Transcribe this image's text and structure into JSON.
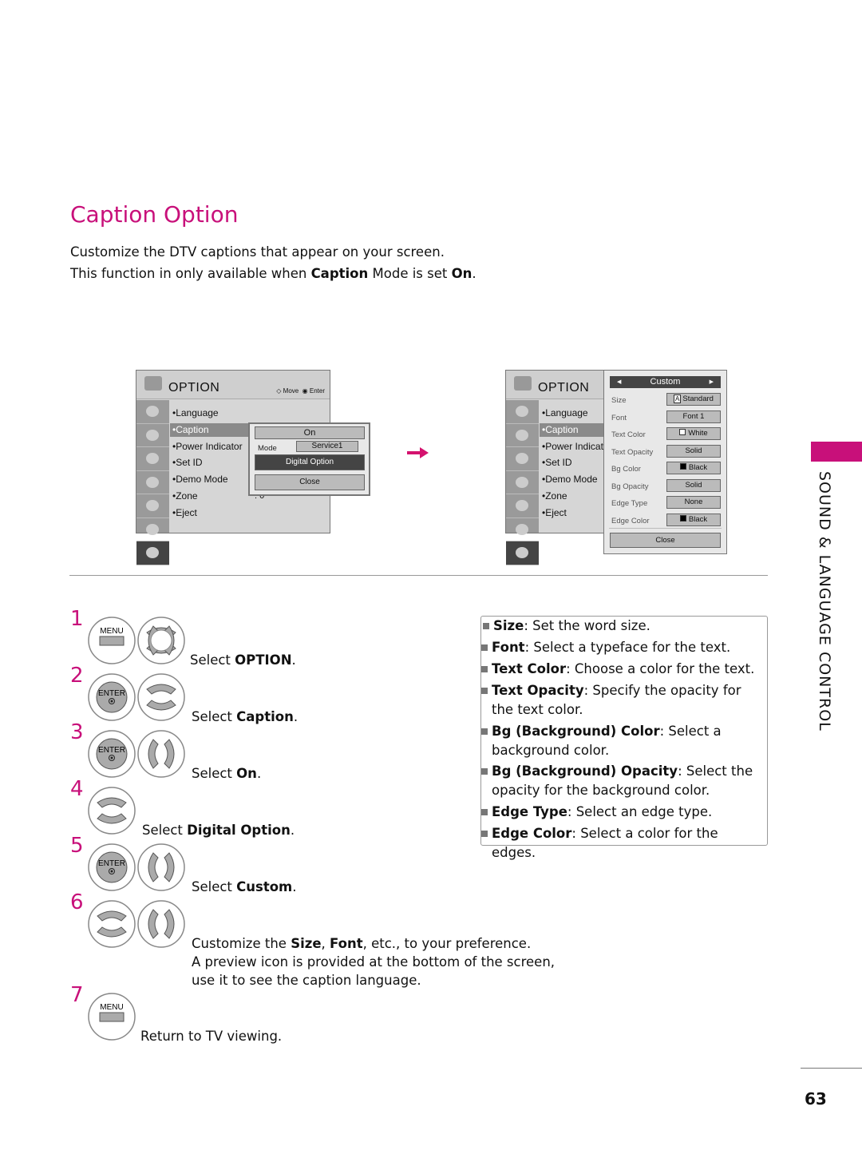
{
  "title": "Caption Option",
  "intro": {
    "line1": "Customize the DTV captions that appear on your screen.",
    "line2_pre": "This function in only available when ",
    "line2_b": "Caption",
    "line2_mid": " Mode is set ",
    "line2_b2": "On",
    "line2_end": "."
  },
  "menu_left": {
    "title": "OPTION",
    "hint_move": "Move",
    "hint_enter": "Enter",
    "items": [
      "Language",
      "Caption",
      "Power Indicator",
      "Set ID",
      "Demo Mode",
      "Zone",
      "Eject"
    ],
    "zone_value": ": 0",
    "popup": {
      "on": "On",
      "mode_label": "Mode",
      "mode_value": "Service1",
      "digital": "Digital Option",
      "close": "Close"
    }
  },
  "menu_right": {
    "title": "OPTION",
    "items": [
      "Language",
      "Caption",
      "Power Indicate",
      "Set ID",
      "Demo Mode",
      "Zone",
      "Eject"
    ],
    "custom": {
      "header": "Custom",
      "rows": [
        {
          "label": "Size",
          "value": "Standard"
        },
        {
          "label": "Font",
          "value": "Font 1"
        },
        {
          "label": "Text Color",
          "value": "White"
        },
        {
          "label": "Text Opacity",
          "value": "Solid"
        },
        {
          "label": "Bg Color",
          "value": "Black"
        },
        {
          "label": "Bg Opacity",
          "value": "Solid"
        },
        {
          "label": "Edge Type",
          "value": "None"
        },
        {
          "label": "Edge Color",
          "value": "Black"
        }
      ],
      "close": "Close"
    }
  },
  "arrow_color": "#d4126e",
  "accent": "#c8107a",
  "steps": [
    {
      "n": "1",
      "buttons": [
        "menu",
        "dpad"
      ],
      "parts": [
        [
          "Select ",
          0
        ],
        [
          "OPTION",
          1
        ],
        [
          ".",
          0
        ]
      ]
    },
    {
      "n": "2",
      "buttons": [
        "enter",
        "updown"
      ],
      "parts": [
        [
          "Select ",
          0
        ],
        [
          "Caption",
          1
        ],
        [
          ".",
          0
        ]
      ]
    },
    {
      "n": "3",
      "buttons": [
        "enter",
        "leftright"
      ],
      "parts": [
        [
          "Select ",
          0
        ],
        [
          "On",
          1
        ],
        [
          ".",
          0
        ]
      ]
    },
    {
      "n": "4",
      "buttons": [
        "updown"
      ],
      "parts": [
        [
          "Select ",
          0
        ],
        [
          "Digital Option",
          1
        ],
        [
          ".",
          0
        ]
      ]
    },
    {
      "n": "5",
      "buttons": [
        "enter",
        "leftright"
      ],
      "parts": [
        [
          "Select ",
          0
        ],
        [
          "Custom",
          1
        ],
        [
          ".",
          0
        ]
      ]
    },
    {
      "n": "6",
      "buttons": [
        "updown",
        "leftright"
      ],
      "parts": [
        [
          "Customize the ",
          0
        ],
        [
          "Size",
          1
        ],
        [
          ", ",
          0
        ],
        [
          "Font",
          1
        ],
        [
          ", etc., to your preference.",
          0
        ],
        [
          "\nA preview icon is provided at the bottom of the screen,\nuse it to see the caption language.",
          0
        ]
      ]
    },
    {
      "n": "7",
      "buttons": [
        "menu"
      ],
      "parts": [
        [
          "Return to TV viewing.",
          0
        ]
      ]
    }
  ],
  "button_labels": {
    "menu": "MENU",
    "enter": "ENTER"
  },
  "features": [
    {
      "label": "Size",
      "text": ": Set the word size."
    },
    {
      "label": "Font",
      "text": ": Select a typeface for the text."
    },
    {
      "label": "Text Color",
      "text": ": Choose a color for the text."
    },
    {
      "label": "Text Opacity",
      "text": ": Specify the opacity for the text color."
    },
    {
      "label": "Bg (Background) Color",
      "text": ": Select a background color."
    },
    {
      "label": "Bg (Background) Opacity",
      "text": ": Select the opacity for the background color."
    },
    {
      "label": "Edge Type",
      "text": ": Select an edge type."
    },
    {
      "label": "Edge Color",
      "text": ": Select a color for the edges."
    }
  ],
  "side_tab": "SOUND & LANGUAGE CONTROL",
  "page_number": "63"
}
